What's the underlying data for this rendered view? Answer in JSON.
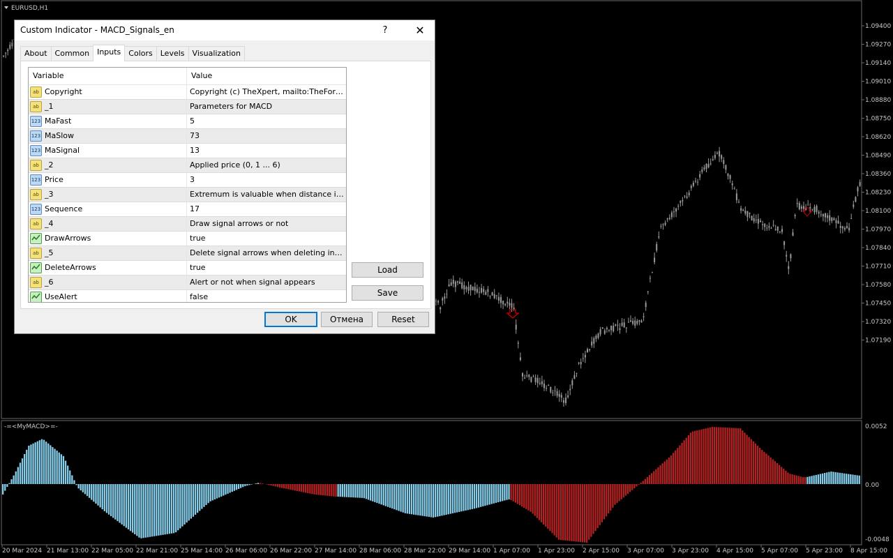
{
  "chart": {
    "symbol_label": "EURUSD,H1",
    "price_axis": [
      "1.09400",
      "1.09270",
      "1.09140",
      "1.09010",
      "1.08880",
      "1.08750",
      "1.08620",
      "1.08490",
      "1.08360",
      "1.08230",
      "1.08100",
      "1.07970",
      "1.07840",
      "1.07710",
      "1.07580",
      "1.07450",
      "1.07320",
      "1.07190"
    ],
    "indicator_label": "-=<MyMACD>=-",
    "indicator_axis": [
      "0.0052",
      "0.00",
      "-0.0048"
    ],
    "time_axis": [
      "20 Mar 2024",
      "21 Mar 13:00",
      "22 Mar 05:00",
      "22 Mar 21:00",
      "25 Mar 14:00",
      "26 Mar 06:00",
      "26 Mar 22:00",
      "27 Mar 14:00",
      "28 Mar 06:00",
      "28 Mar 22:00",
      "29 Mar 14:00",
      "1 Apr 07:00",
      "1 Apr 23:00",
      "2 Apr 15:00",
      "3 Apr 07:00",
      "3 Apr 23:00",
      "4 Apr 15:00",
      "5 Apr 07:00",
      "5 Apr 23:00",
      "8 Apr 15:00"
    ],
    "colors": {
      "background": "#000000",
      "candle": "#9a9a9a",
      "histogram_up": "#87ceeb",
      "histogram_down": "#b22222",
      "arrow": "#cc0000"
    }
  },
  "dialog": {
    "title": "Custom Indicator - MACD_Signals_en",
    "help_label": "?",
    "close_label": "✕",
    "tabs": [
      "About",
      "Common",
      "Inputs",
      "Colors",
      "Levels",
      "Visualization"
    ],
    "active_tab": "Inputs",
    "grid_headers": {
      "variable": "Variable",
      "value": "Value"
    },
    "rows": [
      {
        "type": "string",
        "icon": "ab",
        "variable": "Copyright",
        "value": "Copyright (c) TheXpert, mailto:TheForEXpert..."
      },
      {
        "type": "string",
        "icon": "ab",
        "variable": "_1",
        "value": "Parameters for MACD"
      },
      {
        "type": "int",
        "icon": "123",
        "variable": "MaFast",
        "value": "5"
      },
      {
        "type": "int",
        "icon": "123",
        "variable": "MaSlow",
        "value": "73"
      },
      {
        "type": "int",
        "icon": "123",
        "variable": "MaSignal",
        "value": "13"
      },
      {
        "type": "string",
        "icon": "ab",
        "variable": "_2",
        "value": "Applied price (0, 1 ... 6)"
      },
      {
        "type": "int",
        "icon": "123",
        "variable": "Price",
        "value": "3"
      },
      {
        "type": "string",
        "icon": "ab",
        "variable": "_3",
        "value": "Extremum is valuable when distance in bars f..."
      },
      {
        "type": "int",
        "icon": "123",
        "variable": "Sequence",
        "value": "17"
      },
      {
        "type": "string",
        "icon": "ab",
        "variable": "_4",
        "value": "Draw signal arrows or not"
      },
      {
        "type": "bool",
        "icon": "",
        "variable": "DrawArrows",
        "value": "true"
      },
      {
        "type": "string",
        "icon": "ab",
        "variable": "_5",
        "value": "Delete signal arrows when deleting indicator ..."
      },
      {
        "type": "bool",
        "icon": "",
        "variable": "DeleteArrows",
        "value": "true"
      },
      {
        "type": "string",
        "icon": "ab",
        "variable": "_6",
        "value": "Alert or not when signal appears"
      },
      {
        "type": "bool",
        "icon": "",
        "variable": "UseAlert",
        "value": "false"
      }
    ],
    "load_label": "Load",
    "save_label": "Save",
    "ok_label": "OK",
    "cancel_label": "Отмена",
    "reset_label": "Reset"
  }
}
